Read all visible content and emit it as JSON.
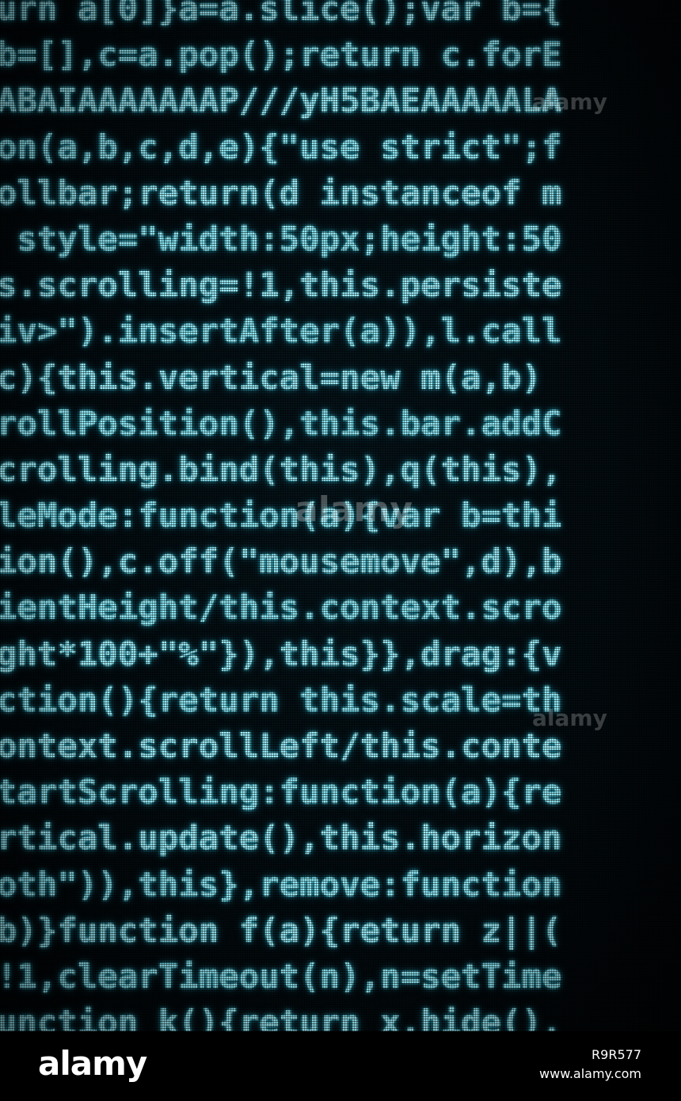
{
  "photo": {
    "code_lines": [
      "urn a[0]}a=a.slice();var b={",
      "b=[],c=a.pop();return c.forE",
      "ABAIAAAAAAAP///yH5BAEAAAAALA",
      "on(a,b,c,d,e){\"use strict\";f",
      "ollbar;return(d instanceof m",
      " style=\"width:50px;height:50",
      "s.scrolling=!1,this.persiste",
      "iv>\").insertAfter(a)),l.call",
      "c){this.vertical=new m(a,b)",
      "rollPosition(),this.bar.addC",
      "crolling.bind(this),q(this),",
      "leMode:function(a){var b=thi",
      "ion(),c.off(\"mousemove\",d),b",
      "ientHeight/this.context.scro",
      "ght*100+\"%\"}),this}},drag:{v",
      "ction(){return this.scale=th",
      "ontext.scrollLeft/this.conte",
      "tartScrolling:function(a){re",
      "rtical.update(),this.horizon",
      "oth\")),this},remove:function",
      "b)}function f(a){return z||(",
      "!1,clearTimeout(n),n=setTime",
      "unction k(){return x.hide(),"
    ],
    "code_color": "#8fe6f2",
    "glow_color": "#3cc8e1",
    "background_color": "#030b0f",
    "watermark_text": "alamy"
  },
  "footer": {
    "logo_text": "alamy",
    "image_id": "R9R577",
    "url": "www.alamy.com"
  }
}
